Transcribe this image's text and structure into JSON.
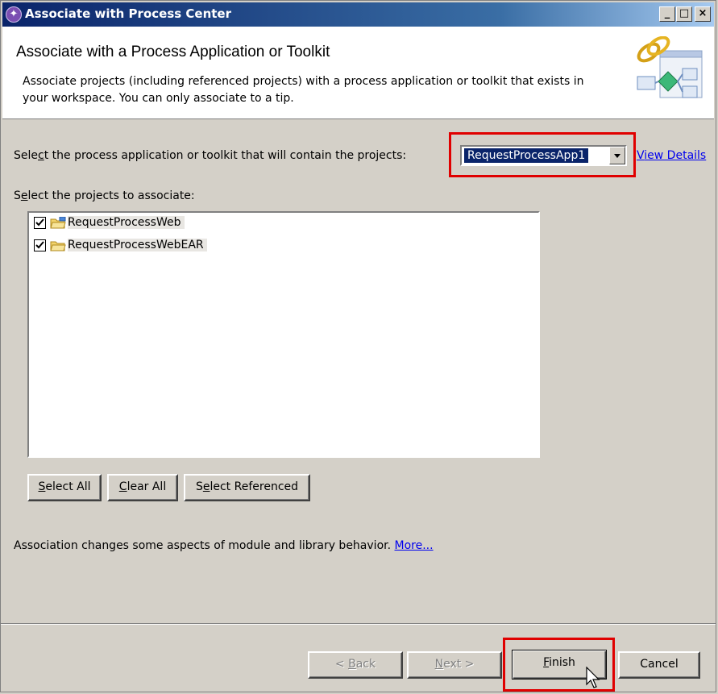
{
  "window": {
    "title": "Associate with Process Center",
    "controls": {
      "minimize": "_",
      "maximize": "□",
      "close": "×"
    }
  },
  "header": {
    "title": "Associate with a Process Application or Toolkit",
    "description": "Associate projects (including referenced projects) with a process application or toolkit that exists in your workspace. You can only associate to a tip."
  },
  "select_process": {
    "label_pre": "Sele",
    "label_mnemonic": "c",
    "label_post": "t the process application or toolkit that will contain the projects:",
    "selected_value": "RequestProcessApp1",
    "view_details_pre": "",
    "view_details_mnemonic": "V",
    "view_details_post": "iew Details"
  },
  "projects": {
    "label_pre": "S",
    "label_mnemonic": "e",
    "label_post": "lect the projects to associate:",
    "items": [
      {
        "label": "RequestProcessWeb",
        "checked": true
      },
      {
        "label": "RequestProcessWebEAR",
        "checked": true
      }
    ]
  },
  "selection_buttons": {
    "select_all": {
      "mnemonic": "S",
      "rest": "elect All"
    },
    "clear_all": {
      "mnemonic": "C",
      "rest": "lear All"
    },
    "select_referenced": {
      "pre": "S",
      "mnemonic": "e",
      "rest": "lect Referenced"
    }
  },
  "note": {
    "text": "Association changes some aspects of module and library behavior.",
    "more_link": "More..."
  },
  "footer": {
    "back": {
      "pre": "< ",
      "mnemonic": "B",
      "rest": "ack"
    },
    "next": {
      "mnemonic": "N",
      "rest": "ext >"
    },
    "finish": {
      "mnemonic": "F",
      "rest": "inish"
    },
    "cancel": "Cancel"
  },
  "colors": {
    "highlight_box": "#e00000",
    "title_bar": "#0a246a",
    "selection": "#0a246a",
    "link": "#0000ee"
  }
}
